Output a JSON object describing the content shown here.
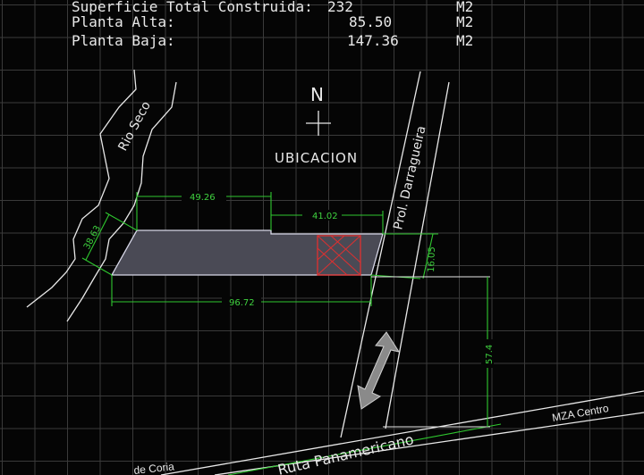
{
  "summary": {
    "rows": [
      {
        "label": "Superficie Total Construida:",
        "value": "232",
        "unit": "M2"
      },
      {
        "label": "Planta Alta:",
        "value": "85.50",
        "unit": "M2"
      },
      {
        "label": "Planta Baja:",
        "value": "147.36",
        "unit": "M2"
      }
    ]
  },
  "north_label": "N",
  "location_title": "UBICACION",
  "streets": {
    "river": "Rio Seco",
    "prolongation": "Prol. Darragueira",
    "highway": "Ruta Panamericano",
    "mza_centro": "MZA Centro",
    "coria": "de Coria"
  },
  "dimensions": {
    "top_left": "49.26",
    "top_right": "41.02",
    "bottom": "96.72",
    "left": "38.63",
    "right": "16.05",
    "vertical": "57.4"
  },
  "colors": {
    "grid": "#3a3a3a",
    "dimension": "#2fc82f",
    "outline": "#e8e8e8",
    "lot_fill": "#4a4a55",
    "building": "#e03030",
    "arrow": "#8a8a8a"
  }
}
